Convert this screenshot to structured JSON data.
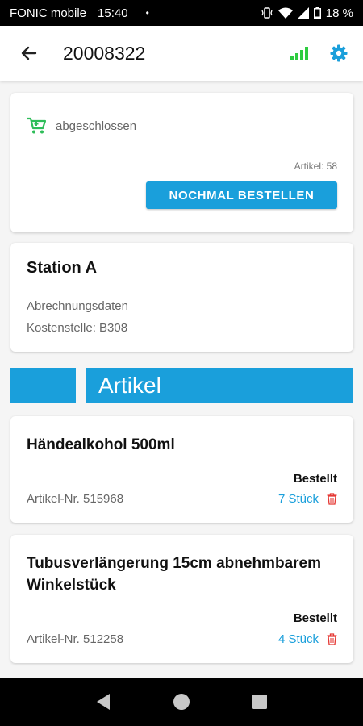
{
  "status_bar": {
    "carrier": "FONIC mobile",
    "time": "15:40",
    "dot": "•",
    "battery": "18 %"
  },
  "app_bar": {
    "title": "20008322",
    "back_icon": "arrow-back-icon",
    "signal_icon": "signal-icon",
    "settings_icon": "gear-icon"
  },
  "order": {
    "status_icon": "shopping-cart-icon",
    "status_label": "abgeschlossen",
    "article_count": "Artikel: 58",
    "reorder_label": "NOCHMAL BESTELLEN"
  },
  "station": {
    "name": "Station A",
    "billing_label": "Abrechnungsdaten",
    "cost_center": "Kostenstelle: B308"
  },
  "section": {
    "title": "Artikel"
  },
  "items": [
    {
      "name": "Händealkohol 500ml",
      "state": "Bestellt",
      "article_no": "Artikel-Nr. 515968",
      "quantity": "7 Stück"
    },
    {
      "name": "Tubusverlängerung 15cm abnehmbarem Winkelstück",
      "state": "Bestellt",
      "article_no": "Artikel-Nr. 512258",
      "quantity": "4 Stück"
    }
  ],
  "colors": {
    "accent": "#1a9fdb",
    "signal": "#2ecc40",
    "cart": "#2ebd59",
    "delete": "#e53935"
  }
}
